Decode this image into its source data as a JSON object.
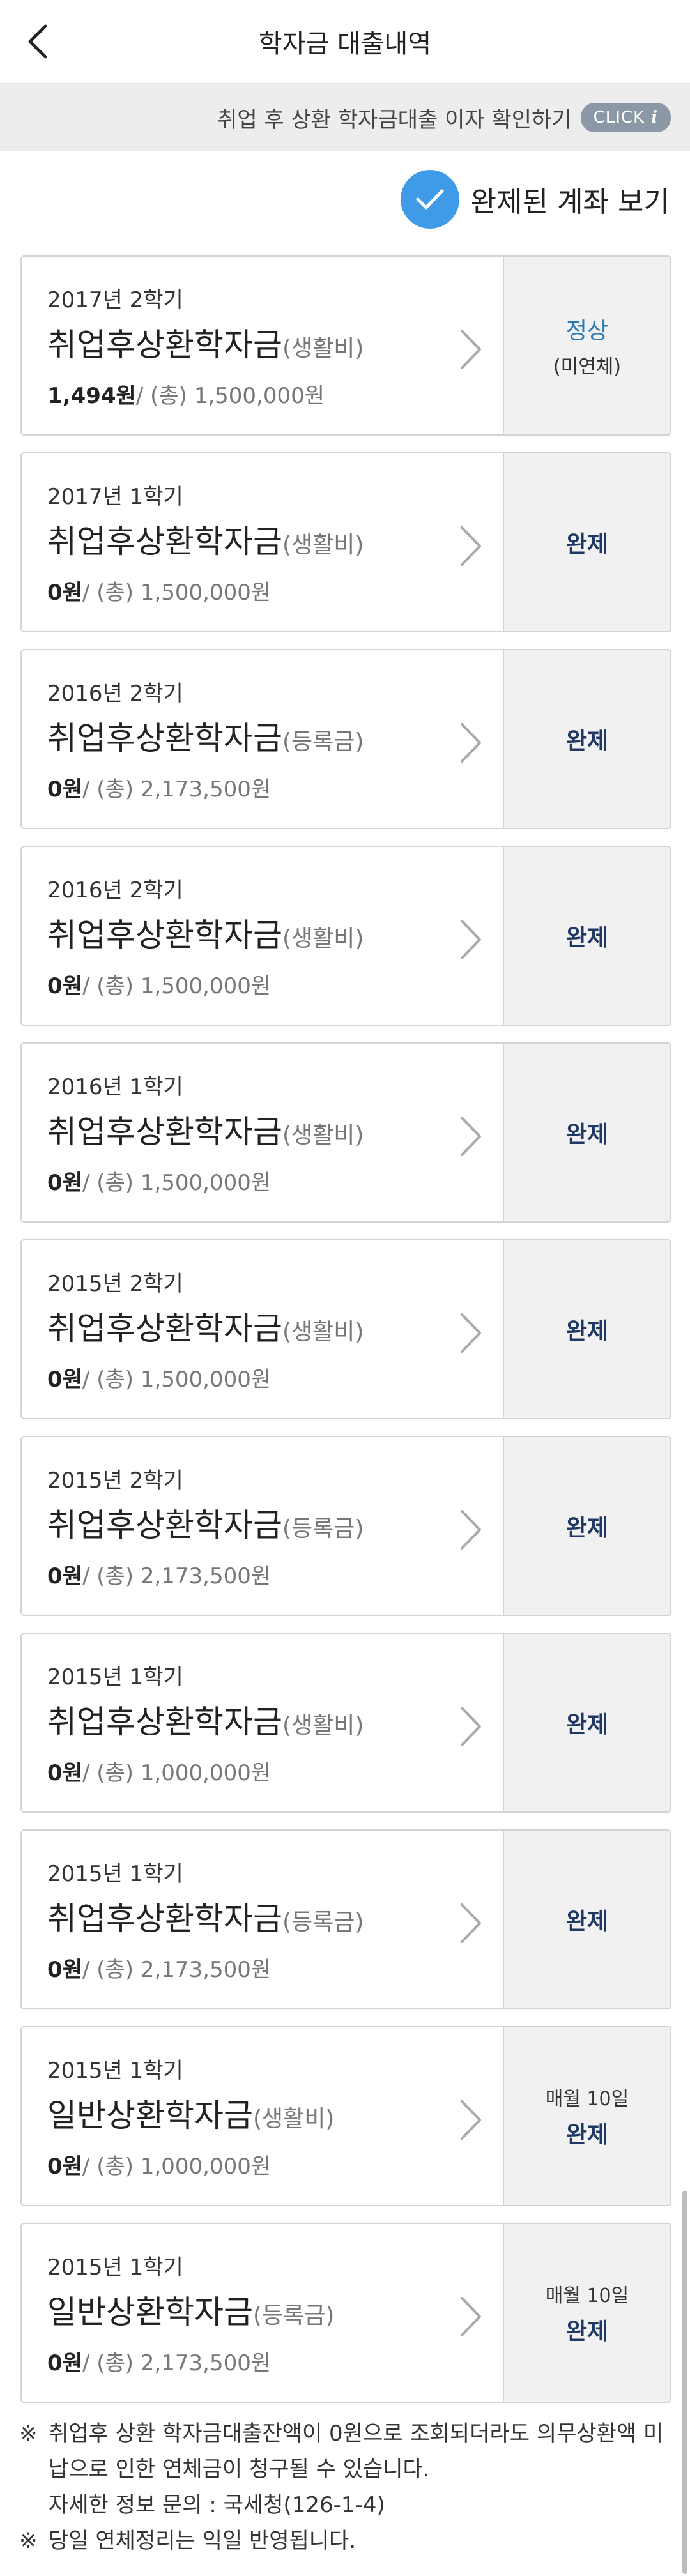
{
  "header": {
    "title": "학자금 대출내역"
  },
  "info_bar": {
    "text": "취업 후 상환 학자금대출 이자 확인하기",
    "badge": "CLICK"
  },
  "toggle": {
    "label": "완제된 계좌 보기"
  },
  "loans": [
    {
      "term": "2017년 2학기",
      "name": "취업후상환학자금",
      "type": "(생활비)",
      "balance": "1,494원",
      "total": "/ (총) 1,500,000원",
      "status_pre": "",
      "status": "정상",
      "status_sub": "(미연체)"
    },
    {
      "term": "2017년 1학기",
      "name": "취업후상환학자금",
      "type": "(생활비)",
      "balance": "0원",
      "total": "/ (총) 1,500,000원",
      "status_pre": "",
      "status": "완제",
      "status_sub": ""
    },
    {
      "term": "2016년 2학기",
      "name": "취업후상환학자금",
      "type": "(등록금)",
      "balance": "0원",
      "total": "/ (총) 2,173,500원",
      "status_pre": "",
      "status": "완제",
      "status_sub": ""
    },
    {
      "term": "2016년 2학기",
      "name": "취업후상환학자금",
      "type": "(생활비)",
      "balance": "0원",
      "total": "/ (총) 1,500,000원",
      "status_pre": "",
      "status": "완제",
      "status_sub": ""
    },
    {
      "term": "2016년 1학기",
      "name": "취업후상환학자금",
      "type": "(생활비)",
      "balance": "0원",
      "total": "/ (총) 1,500,000원",
      "status_pre": "",
      "status": "완제",
      "status_sub": ""
    },
    {
      "term": "2015년 2학기",
      "name": "취업후상환학자금",
      "type": "(생활비)",
      "balance": "0원",
      "total": "/ (총) 1,500,000원",
      "status_pre": "",
      "status": "완제",
      "status_sub": ""
    },
    {
      "term": "2015년 2학기",
      "name": "취업후상환학자금",
      "type": "(등록금)",
      "balance": "0원",
      "total": "/ (총) 2,173,500원",
      "status_pre": "",
      "status": "완제",
      "status_sub": ""
    },
    {
      "term": "2015년 1학기",
      "name": "취업후상환학자금",
      "type": "(생활비)",
      "balance": "0원",
      "total": "/ (총) 1,000,000원",
      "status_pre": "",
      "status": "완제",
      "status_sub": ""
    },
    {
      "term": "2015년 1학기",
      "name": "취업후상환학자금",
      "type": "(등록금)",
      "balance": "0원",
      "total": "/ (총) 2,173,500원",
      "status_pre": "",
      "status": "완제",
      "status_sub": ""
    },
    {
      "term": "2015년 1학기",
      "name": "일반상환학자금",
      "type": "(생활비)",
      "balance": "0원",
      "total": "/ (총) 1,000,000원",
      "status_pre": "매월 10일",
      "status": "완제",
      "status_sub": ""
    },
    {
      "term": "2015년 1학기",
      "name": "일반상환학자금",
      "type": "(등록금)",
      "balance": "0원",
      "total": "/ (총) 2,173,500원",
      "status_pre": "매월 10일",
      "status": "완제",
      "status_sub": ""
    }
  ],
  "notes": [
    {
      "mark": "※",
      "lines": [
        "취업후 상환 학자금대출잔액이 0원으로 조회되더라도 의무상환액 미납으로 인한 연체금이 청구될 수 있습니다.",
        "자세한 정보 문의 : 국세청(126-1-4)"
      ]
    },
    {
      "mark": "※",
      "lines": [
        "당일 연체정리는 익일 반영됩니다."
      ]
    }
  ],
  "colors": {
    "accent": "#3f9be8",
    "status_done": "#1f3864",
    "status_normal": "#2a7ab8",
    "badge": "#8c98a6"
  }
}
